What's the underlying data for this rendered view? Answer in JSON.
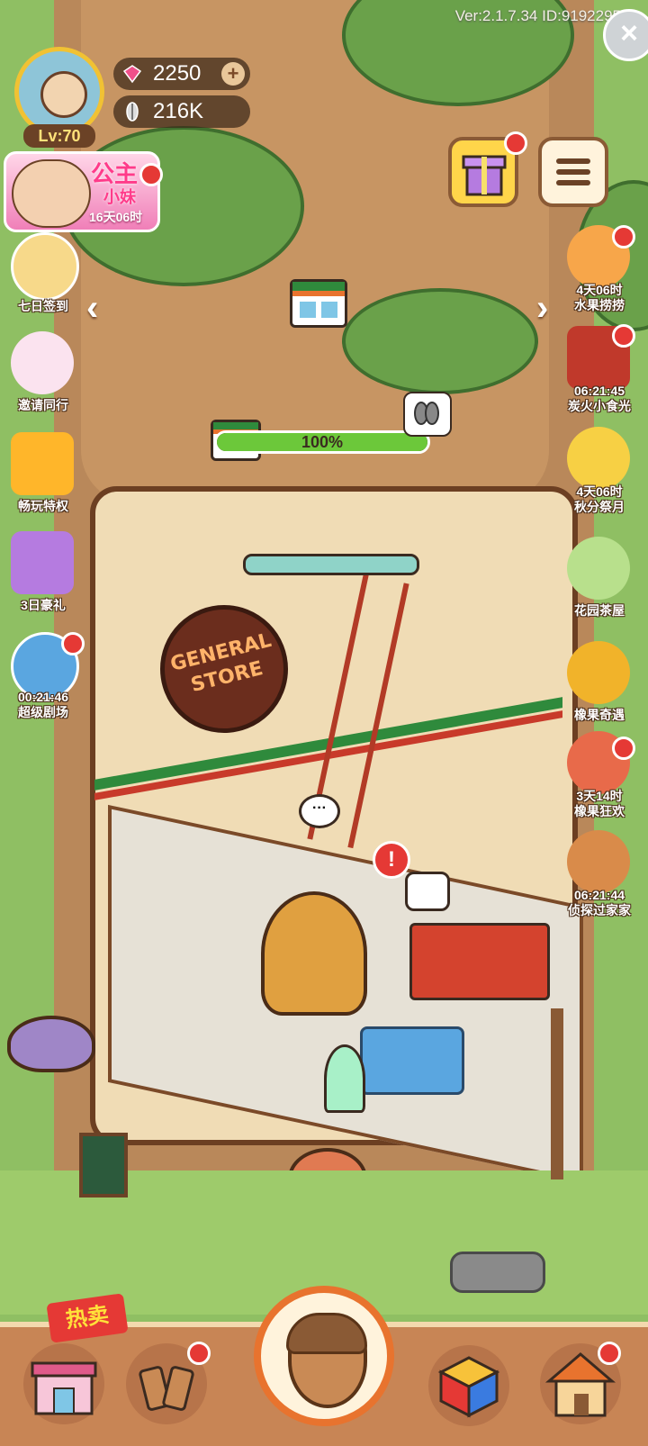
{
  "header": {
    "version": "Ver:2.1.7.34 ID:9192295",
    "level": "Lv:70"
  },
  "currencies": {
    "gems": "2250",
    "seeds": "216K"
  },
  "event_banner": {
    "title": "公主",
    "subtitle": "小妹",
    "timer": "16天06时"
  },
  "left_menu": [
    {
      "label": "七日签到"
    },
    {
      "label": "邀请同行"
    },
    {
      "label": "畅玩特权"
    },
    {
      "label": "3日豪礼"
    },
    {
      "label": "00:21:46\n超级剧场"
    }
  ],
  "right_menu": [
    {
      "timer": "4天06时",
      "label": "水果捞捞"
    },
    {
      "timer": "06:21:45",
      "label": "炭火小食光"
    },
    {
      "timer": "4天06时",
      "label": "秋分祭月"
    },
    {
      "timer": "",
      "label": "花园茶屋"
    },
    {
      "timer": "",
      "label": "橡果奇遇"
    },
    {
      "timer": "3天14时",
      "label": "橡果狂欢"
    },
    {
      "timer": "06:21:44",
      "label": "侦探过家家"
    }
  ],
  "store": {
    "sign_line1": "GENERAL",
    "sign_line2": "STORE",
    "progress_text": "100%",
    "progress_value": 1.0
  },
  "bottom_bar": {
    "hot_label": "热卖"
  },
  "colors": {
    "accent_red": "#e53935",
    "progress_green": "#6cc83a",
    "wood": "#c88555"
  }
}
